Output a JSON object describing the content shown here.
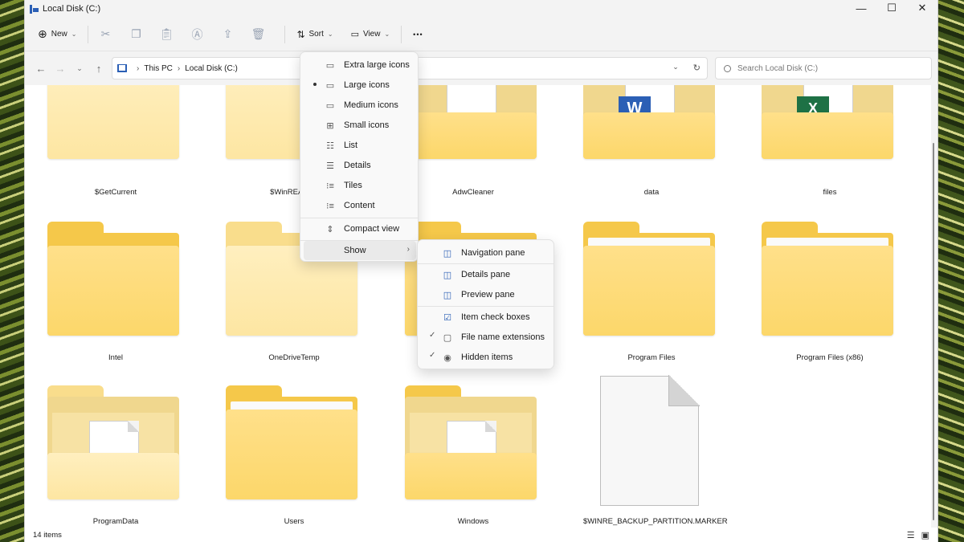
{
  "window": {
    "title": "Local Disk (C:)"
  },
  "window_controls": {
    "minimize": "—",
    "maximize": "☐",
    "close": "✕"
  },
  "toolbar": {
    "new_label": "New",
    "sort_label": "Sort",
    "view_label": "View",
    "more": "•••"
  },
  "address": {
    "crumbs": [
      "This PC",
      "Local Disk (C:)"
    ],
    "search_placeholder": "Search Local Disk (C:)"
  },
  "items": [
    {
      "name": "$GetCurrent",
      "kind": "folder-light"
    },
    {
      "name": "$WinREAgent",
      "kind": "folder-light"
    },
    {
      "name": "AdwCleaner",
      "kind": "folder-doc"
    },
    {
      "name": "data",
      "kind": "folder-word"
    },
    {
      "name": "files",
      "kind": "folder-excel"
    },
    {
      "name": "Intel",
      "kind": "folder"
    },
    {
      "name": "OneDriveTemp",
      "kind": "folder-light"
    },
    {
      "name": "Program Files",
      "kind": "folder"
    },
    {
      "name": "Program Files (x86)",
      "kind": "folder"
    },
    {
      "name": "ProgramData",
      "kind": "folder-open-light"
    },
    {
      "name": "Users",
      "kind": "folder"
    },
    {
      "name": "Windows",
      "kind": "folder-open"
    },
    {
      "name": "$WINRE_BACKUP_PARTITION.MARKER",
      "kind": "file"
    }
  ],
  "status": {
    "count": "14 items"
  },
  "view_menu": {
    "items": [
      {
        "label": "Extra large icons",
        "icon": "monitor-icon"
      },
      {
        "label": "Large icons",
        "icon": "monitor-icon",
        "selected": true
      },
      {
        "label": "Medium icons",
        "icon": "monitor-icon"
      },
      {
        "label": "Small icons",
        "icon": "grid-icon"
      },
      {
        "label": "List",
        "icon": "list-icon"
      },
      {
        "label": "Details",
        "icon": "details-icon"
      },
      {
        "label": "Tiles",
        "icon": "tiles-icon"
      },
      {
        "label": "Content",
        "icon": "content-icon"
      }
    ],
    "compact_view": "Compact view",
    "show": "Show"
  },
  "show_menu": {
    "items": [
      {
        "label": "Navigation pane",
        "checked": false
      },
      {
        "label": "Details pane",
        "checked": false
      },
      {
        "label": "Preview pane",
        "checked": false
      },
      {
        "label": "Item check boxes",
        "checked": false
      },
      {
        "label": "File name extensions",
        "checked": true
      },
      {
        "label": "Hidden items",
        "checked": true
      }
    ]
  }
}
